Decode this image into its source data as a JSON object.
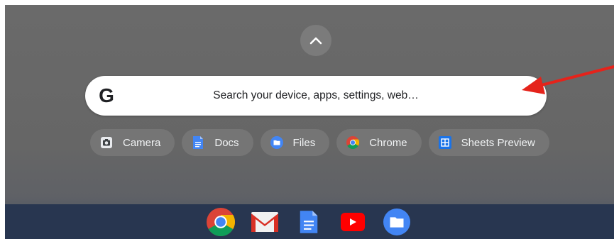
{
  "search": {
    "placeholder": "Search your device, apps, settings, web…",
    "logo_letter": "G"
  },
  "suggestions": [
    {
      "label": "Camera",
      "icon": "camera-icon"
    },
    {
      "label": "Docs",
      "icon": "docs-icon"
    },
    {
      "label": "Files",
      "icon": "files-icon"
    },
    {
      "label": "Chrome",
      "icon": "chrome-icon"
    },
    {
      "label": "Sheets Preview",
      "icon": "sheets-icon"
    }
  ],
  "shelf": {
    "apps": [
      "chrome-icon",
      "gmail-icon",
      "docs-icon",
      "youtube-icon",
      "files-icon"
    ]
  },
  "colors": {
    "annotation_arrow": "#e5231b",
    "shelf": "#283650",
    "chip": "#757575"
  }
}
